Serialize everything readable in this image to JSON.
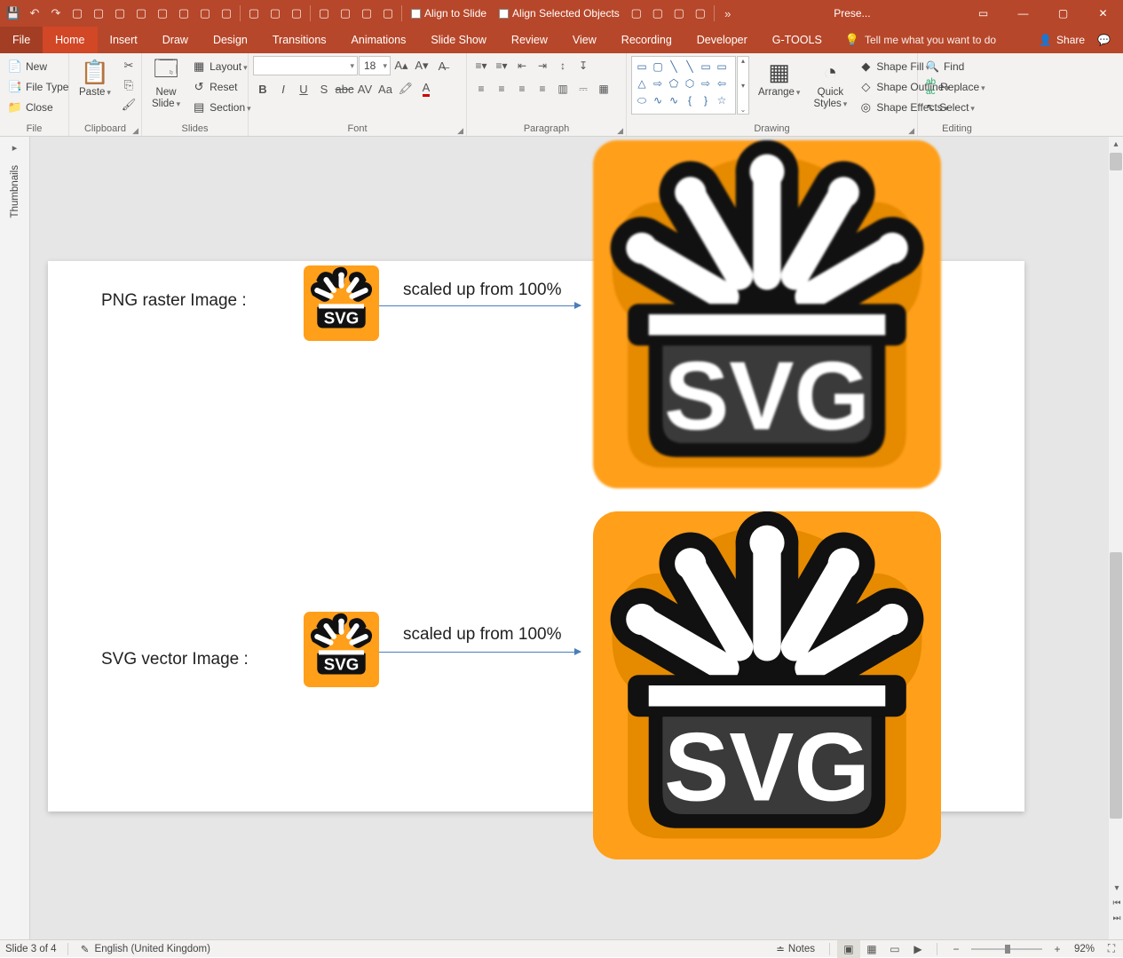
{
  "titlebar": {
    "align_to_slide": "Align to Slide",
    "align_selected": "Align Selected Objects",
    "doc_title": "Prese..."
  },
  "tabs": {
    "file": "File",
    "home": "Home",
    "insert": "Insert",
    "draw": "Draw",
    "design": "Design",
    "transitions": "Transitions",
    "animations": "Animations",
    "slideshow": "Slide Show",
    "review": "Review",
    "view": "View",
    "recording": "Recording",
    "developer": "Developer",
    "gtools": "G-TOOLS",
    "tell_me": "Tell me what you want to do",
    "share": "Share"
  },
  "ribbon": {
    "file_group": {
      "new": "New",
      "file_type": "File Type",
      "close": "Close",
      "label": "File"
    },
    "clipboard": {
      "paste": "Paste",
      "label": "Clipboard"
    },
    "slides": {
      "new_slide": "New",
      "new_slide2": "Slide",
      "layout": "Layout",
      "reset": "Reset",
      "section": "Section",
      "label": "Slides"
    },
    "font": {
      "font_name_placeholder": "",
      "font_size": "18",
      "label": "Font"
    },
    "paragraph": {
      "label": "Paragraph"
    },
    "drawing": {
      "arrange": "Arrange",
      "quick": "Quick",
      "styles": "Styles",
      "shape_fill": "Shape Fill",
      "shape_outline": "Shape Outline",
      "shape_effects": "Shape Effects",
      "label": "Drawing"
    },
    "editing": {
      "find": "Find",
      "replace": "Replace",
      "select": "Select",
      "label": "Editing"
    }
  },
  "thumbnails": {
    "label": "Thumbnails"
  },
  "slide": {
    "png_label": "PNG raster Image :",
    "svg_label": "SVG vector Image :",
    "arrow_label": "scaled up from 100%",
    "logo_text": "SVG"
  },
  "status": {
    "slide_counter": "Slide 3 of 4",
    "language": "English (United Kingdom)",
    "notes": "Notes",
    "zoom_pct": "92%"
  }
}
